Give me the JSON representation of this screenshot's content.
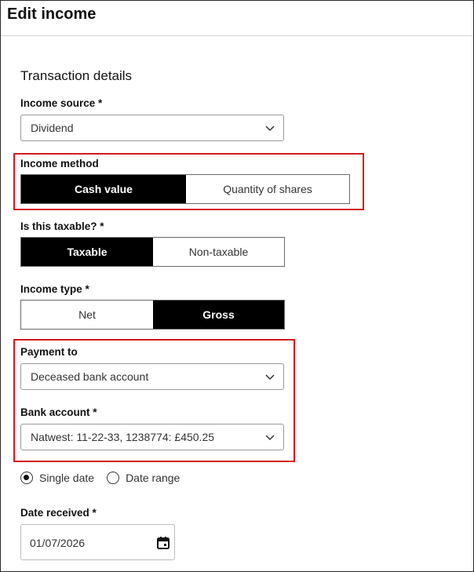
{
  "header": {
    "title": "Edit income"
  },
  "section": {
    "title": "Transaction details"
  },
  "income_source": {
    "label": "Income source *",
    "value": "Dividend"
  },
  "income_method": {
    "label": "Income method",
    "options": [
      "Cash value",
      "Quantity of shares"
    ],
    "selected": "Cash value"
  },
  "taxable": {
    "label": "Is this taxable? *",
    "options": [
      "Taxable",
      "Non-taxable"
    ],
    "selected": "Taxable"
  },
  "income_type": {
    "label": "Income type *",
    "options": [
      "Net",
      "Gross"
    ],
    "selected": "Gross"
  },
  "payment_to": {
    "label": "Payment to",
    "value": "Deceased bank account"
  },
  "bank_account": {
    "label": "Bank account *",
    "value": "Natwest: 11-22-33, 1238774: £450.25"
  },
  "date_mode": {
    "options": [
      "Single date",
      "Date range"
    ],
    "selected": "Single date"
  },
  "date_received": {
    "label": "Date received *",
    "value": "01/07/2026"
  },
  "colors": {
    "highlight": "#d71920",
    "active_segment": "#000000"
  }
}
